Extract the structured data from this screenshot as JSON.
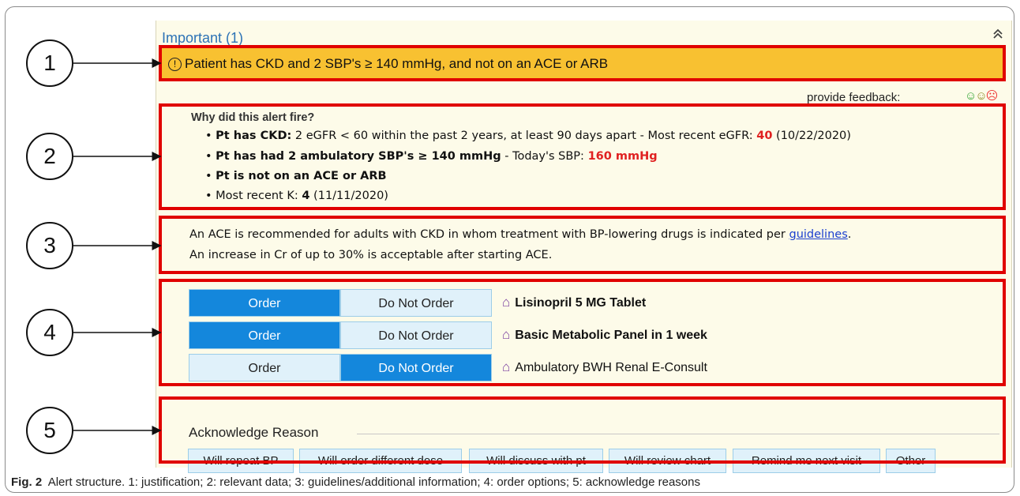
{
  "important_header": {
    "title": "Important (1)",
    "collapse_icon": "chevron-double-up-icon"
  },
  "alert": {
    "icon": "warning-circle-icon",
    "text": "Patient has CKD and 2 SBP's ≥ 140 mmHg, and not on an ACE or ARB",
    "color": "#f8c131"
  },
  "feedback": {
    "label": "provide feedback:",
    "icons": [
      "smiley-happy-icon",
      "smiley-neutral-icon",
      "smiley-sad-icon"
    ]
  },
  "why": {
    "heading": "Why did this alert fire?",
    "bullets": [
      {
        "bold": "Pt has CKD:",
        "text": " 2 eGFR < 60 within the past 2 years, at least 90 days apart - Most recent eGFR: ",
        "value": "40",
        "after": " (10/22/2020)"
      },
      {
        "bold": "Pt has had 2 ambulatory SBP's ≥ 140 mmHg",
        "text": " - Today's SBP: ",
        "value": "160 mmHg"
      },
      {
        "bold": "Pt is not on an ACE or ARB"
      },
      {
        "text": "Most recent K: ",
        "value": "4",
        "after": " (11/11/2020)"
      }
    ]
  },
  "guidelines": {
    "line1_pre": "An ACE is recommended for adults with CKD in whom treatment with BP-lowering drugs is indicated per ",
    "link": "guidelines",
    "line1_post": ".",
    "line2": "An increase in Cr of up to 30% is acceptable after starting ACE."
  },
  "orders": [
    {
      "order_label": "Order",
      "do_not_label": "Do Not Order",
      "selected": "order",
      "name": "Lisinopril 5 MG Tablet",
      "bold": true
    },
    {
      "order_label": "Order",
      "do_not_label": "Do Not Order",
      "selected": "order",
      "name": "Basic Metabolic Panel in 1 week",
      "bold": true
    },
    {
      "order_label": "Order",
      "do_not_label": "Do Not Order",
      "selected": "do_not",
      "name": "Ambulatory BWH Renal E-Consult",
      "bold": false
    }
  ],
  "acknowledge": {
    "label": "Acknowledge Reason",
    "reasons": [
      "Will repeat BP",
      "Will order different dose",
      "Will discuss with pt",
      "Will review chart",
      "Remind me next visit",
      "Other"
    ]
  },
  "callouts": [
    "1",
    "2",
    "3",
    "4",
    "5"
  ],
  "caption": {
    "fig": "Fig. 2",
    "text": "Alert structure. 1: justification; 2: relevant data; 3: guidelines/additional information; 4: order options; 5: acknowledge reasons"
  },
  "colors": {
    "highlight": "#e00000",
    "order_selected": "#1487dc",
    "order_unselected": "#e0f1fa",
    "panel": "#fdfbe9",
    "header_text": "#2c72b5"
  }
}
